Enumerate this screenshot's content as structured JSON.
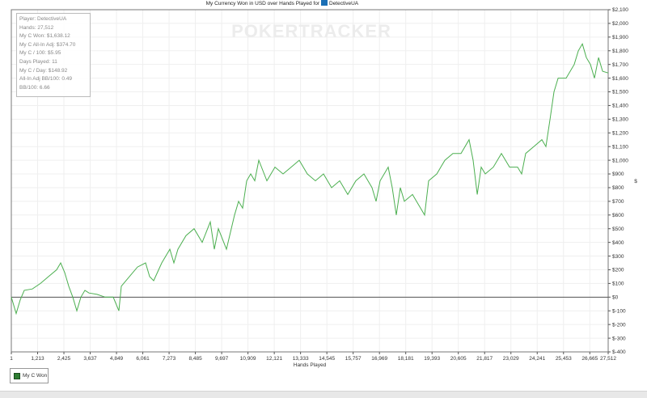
{
  "chart_data": {
    "type": "line",
    "title": "My Currency Won in USD over Hands Played for",
    "title_player": "DetectiveUA",
    "xlabel": "Hands Played",
    "ylabel": "$",
    "xlim": [
      1,
      27512
    ],
    "ylim": [
      -400,
      2100
    ],
    "x_ticks": [
      "1",
      "1,213",
      "2,425",
      "3,637",
      "4,849",
      "6,061",
      "7,273",
      "8,485",
      "9,697",
      "10,909",
      "12,121",
      "13,333",
      "14,545",
      "15,757",
      "16,969",
      "18,181",
      "19,393",
      "20,605",
      "21,817",
      "23,029",
      "24,241",
      "25,453",
      "26,665",
      "27,512"
    ],
    "x_tick_values": [
      1,
      1213,
      2425,
      3637,
      4849,
      6061,
      7273,
      8485,
      9697,
      10909,
      12121,
      13333,
      14545,
      15757,
      16969,
      18181,
      19393,
      20605,
      21817,
      23029,
      24241,
      25453,
      26665,
      27512
    ],
    "y_ticks": [
      "$2,100",
      "$2,000",
      "$1,900",
      "$1,800",
      "$1,700",
      "$1,600",
      "$1,500",
      "$1,400",
      "$1,300",
      "$1,200",
      "$1,100",
      "$1,000",
      "$900",
      "$800",
      "$700",
      "$600",
      "$500",
      "$400",
      "$300",
      "$200",
      "$100",
      "$0",
      "$-100",
      "$-200",
      "$-300",
      "$-400"
    ],
    "y_tick_values": [
      2100,
      2000,
      1900,
      1800,
      1700,
      1600,
      1500,
      1400,
      1300,
      1200,
      1100,
      1000,
      900,
      800,
      700,
      600,
      500,
      400,
      300,
      200,
      100,
      0,
      -100,
      -200,
      -300,
      -400
    ],
    "grid": true,
    "legend_placement": "bottom-left",
    "series": [
      {
        "name": "My C Won",
        "color": "#4caf50",
        "x": [
          1,
          225,
          411,
          597,
          970,
          1343,
          1716,
          2089,
          2275,
          2461,
          2648,
          2834,
          3020,
          3207,
          3393,
          3580,
          3953,
          4325,
          4698,
          4959,
          5071,
          5444,
          5817,
          6189,
          6376,
          6562,
          6935,
          7308,
          7494,
          7680,
          8053,
          8426,
          8799,
          9172,
          9358,
          9545,
          9917,
          10290,
          10477,
          10663,
          10850,
          11036,
          11222,
          11409,
          11782,
          12154,
          12527,
          12900,
          13273,
          13646,
          14018,
          14391,
          14764,
          15137,
          15510,
          15882,
          16255,
          16628,
          16814,
          17001,
          17374,
          17560,
          17747,
          17933,
          18119,
          18492,
          18865,
          19051,
          19238,
          19611,
          19797,
          19984,
          20356,
          20729,
          21102,
          21288,
          21475,
          21661,
          21847,
          22220,
          22593,
          22966,
          23338,
          23525,
          23711,
          24084,
          24457,
          24643,
          24830,
          25016,
          25203,
          25575,
          25948,
          26135,
          26321,
          26507,
          26694,
          26880,
          27067,
          27253,
          27512
        ],
        "y": [
          0,
          -120,
          -20,
          50,
          60,
          100,
          150,
          200,
          250,
          180,
          80,
          0,
          -100,
          0,
          50,
          30,
          20,
          0,
          0,
          -100,
          80,
          150,
          220,
          250,
          150,
          120,
          250,
          350,
          250,
          350,
          450,
          500,
          400,
          550,
          350,
          500,
          350,
          600,
          700,
          650,
          850,
          900,
          850,
          1000,
          850,
          950,
          900,
          950,
          1000,
          900,
          850,
          900,
          800,
          850,
          750,
          850,
          900,
          800,
          700,
          850,
          950,
          800,
          600,
          800,
          700,
          750,
          650,
          600,
          850,
          900,
          950,
          1000,
          1050,
          1050,
          1150,
          1000,
          750,
          950,
          900,
          950,
          1050,
          950,
          950,
          900,
          1050,
          1100,
          1150,
          1100,
          1300,
          1500,
          1600,
          1600,
          1700,
          1800,
          1850,
          1750,
          1700,
          1600,
          1750,
          1650,
          1638
        ]
      }
    ]
  },
  "stats": {
    "lines": [
      "Player: DetectiveUA",
      "Hands: 27,512",
      "My C Won: $1,638.12",
      "My C All-In Adj: $374.70",
      "My C / 100: $5.95",
      "Days Played: 11",
      "My C / Day: $148.92",
      "All-In Adj BB/100: 0.49",
      "BB/100: 6.66"
    ]
  },
  "watermark": "POKERTRACKER",
  "legend": {
    "label": "My C Won"
  }
}
